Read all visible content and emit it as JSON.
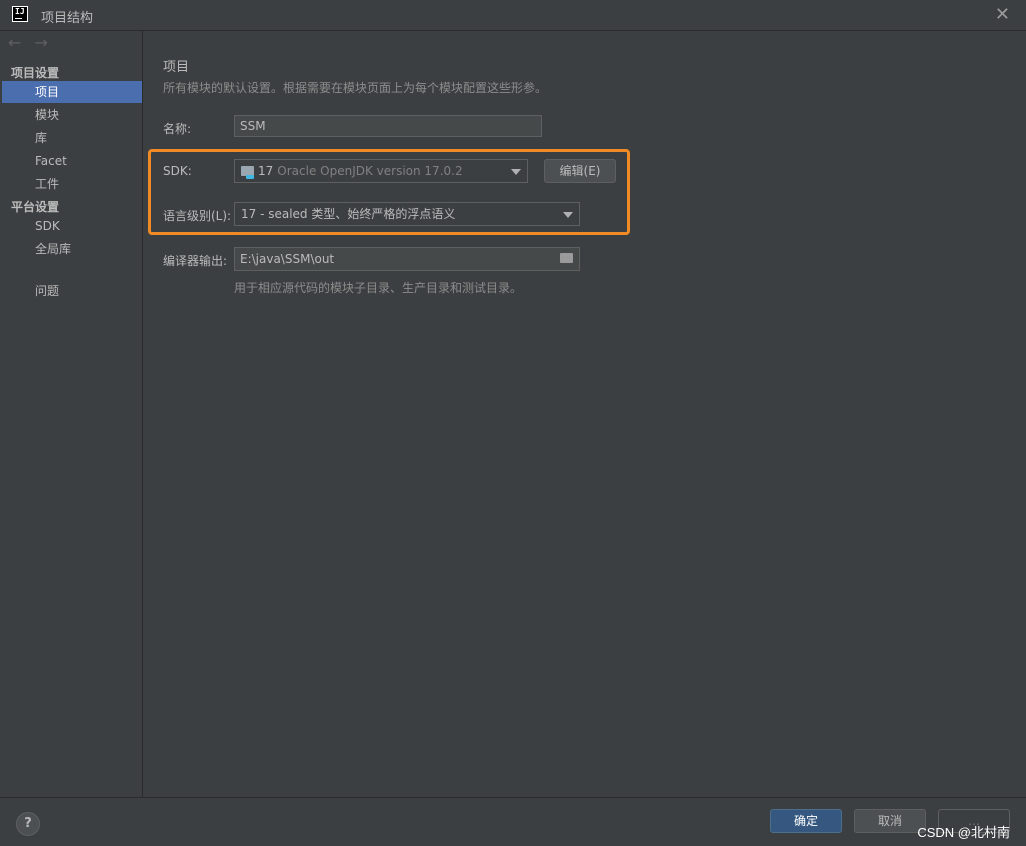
{
  "window": {
    "title": "项目结构",
    "app_icon_text": "IJ"
  },
  "nav": {
    "back": "←",
    "forward": "→"
  },
  "sidebar": {
    "project_settings_heading": "项目设置",
    "platform_settings_heading": "平台设置",
    "items": [
      {
        "label": "项目"
      },
      {
        "label": "模块"
      },
      {
        "label": "库"
      },
      {
        "label": "Facet"
      },
      {
        "label": "工件"
      },
      {
        "label": "SDK"
      },
      {
        "label": "全局库"
      },
      {
        "label": "问题"
      }
    ]
  },
  "main": {
    "title": "项目",
    "description": "所有模块的默认设置。根据需要在模块页面上为每个模块配置这些形参。",
    "name_label": "名称:",
    "name_value": "SSM",
    "sdk_label": "SDK:",
    "sdk_version_num": "17",
    "sdk_value": "Oracle OpenJDK version 17.0.2",
    "edit_button": "编辑(E)",
    "language_level_label": "语言级别(L):",
    "language_level_value": "17 - sealed 类型、始终严格的浮点语义",
    "compiler_output_label": "编译器输出:",
    "compiler_output_value": "E:\\java\\SSM\\out",
    "compiler_output_hint": "用于相应源代码的模块子目录、生产目录和测试目录。"
  },
  "footer": {
    "help": "?",
    "ok": "确定",
    "cancel": "取消",
    "apply": "…"
  },
  "watermark": "CSDN @北村南",
  "colors": {
    "selection": "#4b6eaf",
    "highlight": "#f08a24",
    "primary_button": "#365880"
  }
}
